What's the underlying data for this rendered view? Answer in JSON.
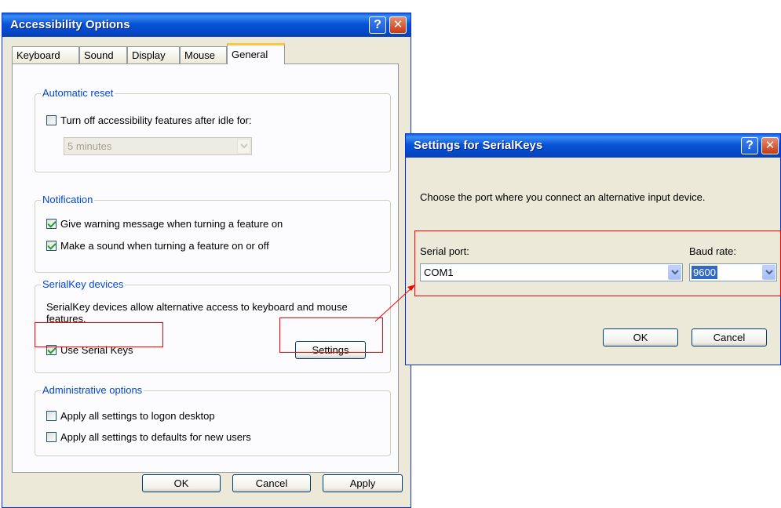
{
  "accessibility": {
    "title": "Accessibility Options",
    "help_button": "?",
    "close_button": "✕",
    "tabs": [
      {
        "label": "Keyboard"
      },
      {
        "label": "Sound"
      },
      {
        "label": "Display"
      },
      {
        "label": "Mouse"
      },
      {
        "label": "General"
      }
    ],
    "active_tab": "General",
    "automatic_reset": {
      "legend": "Automatic reset",
      "checkbox_label": "Turn off accessibility features after idle for:",
      "checked": false,
      "idle_time": "5 minutes"
    },
    "notification": {
      "legend": "Notification",
      "warning_label": "Give warning message when turning a feature on",
      "warning_checked": true,
      "sound_label": "Make a sound when turning a feature on or off",
      "sound_checked": true
    },
    "serialkey": {
      "legend": "SerialKey devices",
      "description": "SerialKey devices allow alternative access to keyboard and mouse features.",
      "use_label": "Use Serial Keys",
      "use_checked": true,
      "settings_label": "Settings"
    },
    "admin": {
      "legend": "Administrative options",
      "logon_label": "Apply all settings to logon desktop",
      "logon_checked": false,
      "defaults_label": "Apply all settings to defaults for new users",
      "defaults_checked": false
    },
    "buttons": {
      "ok": "OK",
      "cancel": "Cancel",
      "apply": "Apply"
    }
  },
  "serialkeys_dialog": {
    "title": "Settings for SerialKeys",
    "help_button": "?",
    "close_button": "✕",
    "instruction": "Choose the port where you connect an alternative input device.",
    "serial_port_label": "Serial port:",
    "serial_port_value": "COM1",
    "baud_rate_label": "Baud rate:",
    "baud_rate_value": "9600",
    "ok": "OK",
    "cancel": "Cancel"
  },
  "colors": {
    "title_bar": "#0754d6",
    "legend_text": "#0046d5",
    "annotation": "#ff0000",
    "dialog_bg": "#ece9d8"
  }
}
